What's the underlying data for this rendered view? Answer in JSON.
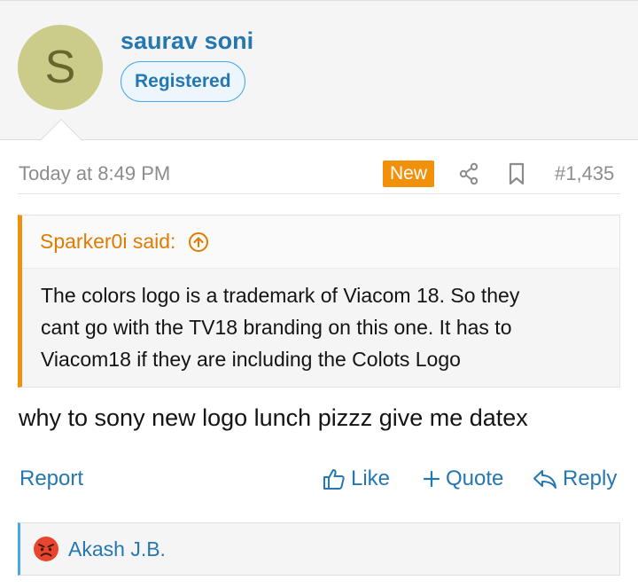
{
  "user": {
    "avatar_letter": "S",
    "name": "saurav soni",
    "role": "Registered"
  },
  "post": {
    "timestamp": "Today at 8:49 PM",
    "new_badge": "New",
    "number": "#1,435",
    "body": "why to sony new logo lunch pizzz give me datex"
  },
  "quote": {
    "author": "Sparker0i said:",
    "lines": [
      "The colors logo is a trademark of Viacom 18. So they",
      "cant go with the TV18 branding on this one. It has to",
      "Viacom18 if they are including the Colots Logo"
    ]
  },
  "actions": {
    "report": "Report",
    "like": "Like",
    "quote": "Quote",
    "reply": "Reply"
  },
  "reactions": {
    "reactor": "Akash J.B."
  },
  "colors": {
    "link": "#2577b1",
    "accent_orange": "#f1900b",
    "badge_border": "#47a7eb"
  },
  "icons": [
    "share-icon",
    "bookmark-icon",
    "arrow-up-circle-icon",
    "thumbs-up-icon",
    "plus-icon",
    "reply-icon",
    "angry-face-icon"
  ]
}
